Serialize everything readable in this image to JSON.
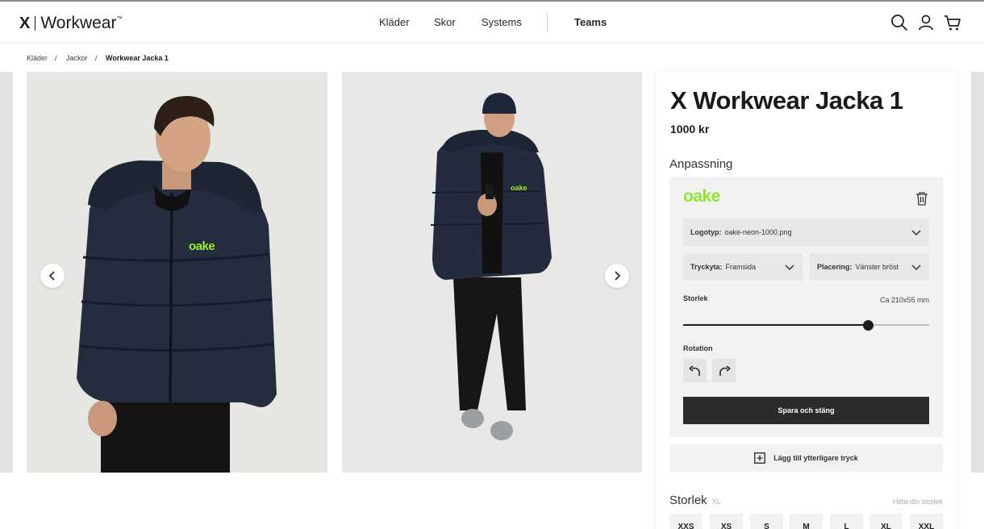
{
  "header": {
    "logo_mark": "X",
    "logo_text": "Workwear",
    "logo_tm": "™",
    "nav": [
      "Kläder",
      "Skor",
      "Systems"
    ],
    "nav_teams": "Teams"
  },
  "breadcrumb": {
    "items": [
      "Kläder",
      "Jackor"
    ],
    "separator": "/",
    "current": "Workwear Jacka 1"
  },
  "gallery": {
    "chest_logo": "oake"
  },
  "product": {
    "title": "X Workwear Jacka 1",
    "price": "1000 kr",
    "section_title": "Anpassning",
    "print": {
      "logo_text": "oake",
      "logo_color": "#8ee62a",
      "logotyp_label": "Logotyp:",
      "logotyp_value": "oake-neon-1000.png",
      "tryckyta_label": "Tryckyta:",
      "tryckyta_value": "Framsida",
      "placering_label": "Placering:",
      "placering_value": "Vänster bröst",
      "size_label": "Storlek",
      "size_value": "Ca 210x55 mm",
      "size_slider_fraction": 0.75,
      "rotation_label": "Rotation",
      "save_label": "Spara och stäng"
    },
    "add_print_label": "Lägg till ytterligare tryck",
    "size_section": {
      "title": "Storlek",
      "selected": "XL",
      "find_size": "Hitta din storlek",
      "sizes": [
        "XXS",
        "XS",
        "S",
        "M",
        "L",
        "XL",
        "XXL"
      ]
    }
  }
}
